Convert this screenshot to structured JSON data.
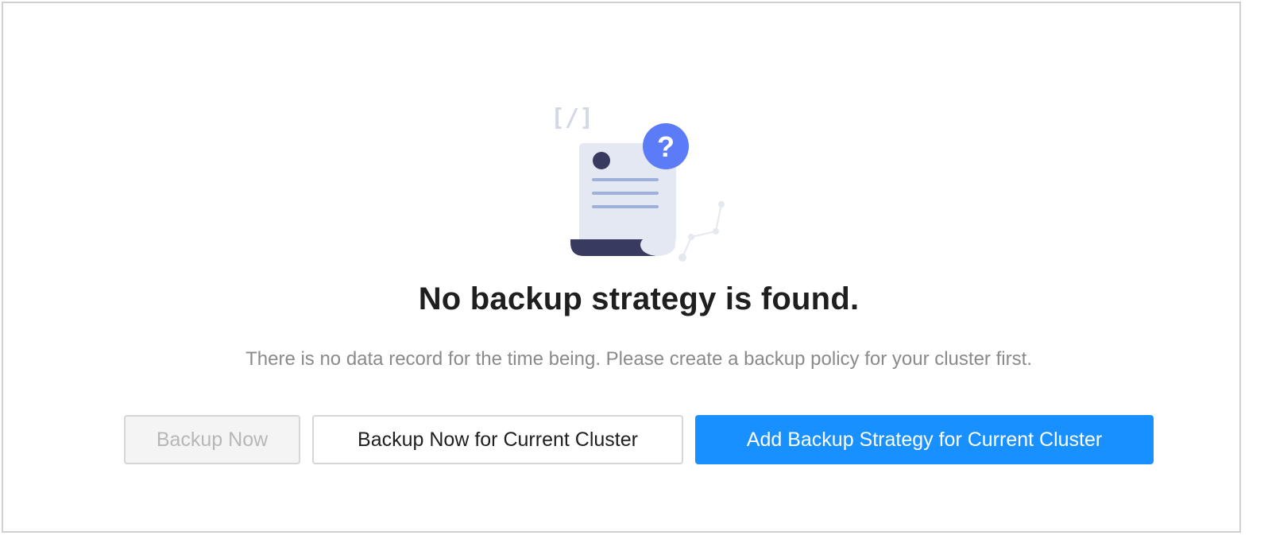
{
  "empty_state": {
    "title": "No backup strategy is found.",
    "description": "There is no data record for the time being. Please create a backup policy for your cluster first.",
    "illustration": {
      "icon_name": "document-question-icon",
      "code_glyph": "[/]",
      "question_glyph": "?"
    }
  },
  "actions": {
    "backup_now_label": "Backup Now",
    "backup_now_current_label": "Backup Now for Current Cluster",
    "add_strategy_label": "Add Backup Strategy for Current Cluster"
  },
  "colors": {
    "primary": "#1890ff",
    "title_text": "#1f1f1f",
    "description_text": "#8a8a8a",
    "disabled_text": "#b7b7b7",
    "illustration_paper": "#e4e8f3",
    "illustration_dark": "#383b5f",
    "illustration_accent": "#5b7cf6"
  }
}
